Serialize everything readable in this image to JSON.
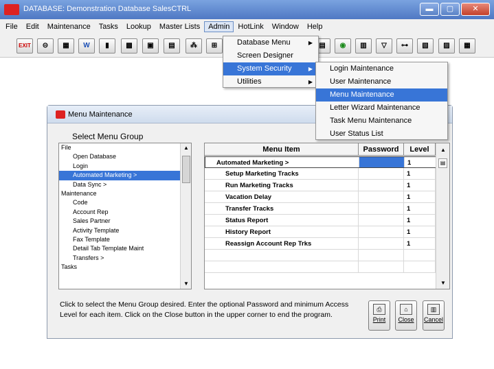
{
  "window": {
    "title": "DATABASE: Demonstration Database          SalesCTRL",
    "min_label": "▬",
    "max_label": "▢",
    "close_label": "✕"
  },
  "menubar": [
    "File",
    "Edit",
    "Maintenance",
    "Tasks",
    "Lookup",
    "Master Lists",
    "Admin",
    "HotLink",
    "Window",
    "Help"
  ],
  "toolbar": {
    "exit_label": "EXIT",
    "word_label": "W"
  },
  "admin_menu": [
    {
      "label": "Database Menu",
      "submenu": true
    },
    {
      "label": "Screen Designer",
      "submenu": false
    },
    {
      "label": "System Security",
      "submenu": true
    },
    {
      "label": "Utilities",
      "submenu": true
    }
  ],
  "security_menu": [
    "Login Maintenance",
    "User Maintenance",
    "Menu Maintenance",
    "Letter Wizard Maintenance",
    "Task Menu Maintenance",
    "User Status List"
  ],
  "child": {
    "title": "Menu Maintenance",
    "group_label": "Select Menu Group",
    "groups": [
      {
        "label": "File",
        "level": 1
      },
      {
        "label": "Open Database",
        "level": 2
      },
      {
        "label": "Login",
        "level": 2
      },
      {
        "label": "Automated Marketing >",
        "level": 2,
        "selected": true
      },
      {
        "label": "Data Sync >",
        "level": 2
      },
      {
        "label": "Maintenance",
        "level": 1
      },
      {
        "label": "Code",
        "level": 2
      },
      {
        "label": "Account Rep",
        "level": 2
      },
      {
        "label": "Sales Partner",
        "level": 2
      },
      {
        "label": "Activity Template",
        "level": 2
      },
      {
        "label": "Fax Template",
        "level": 2
      },
      {
        "label": "Detail Tab Template Maint",
        "level": 2
      },
      {
        "label": "Transfers >",
        "level": 2
      },
      {
        "label": "Tasks",
        "level": 1
      }
    ],
    "grid_headers": {
      "item": "Menu Item",
      "password": "Password",
      "level": "Level"
    },
    "grid_rows": [
      {
        "item": "Automated Marketing >",
        "level": "1",
        "top": true
      },
      {
        "item": "Setup Marketing Tracks",
        "level": "1"
      },
      {
        "item": "Run Marketing Tracks",
        "level": "1"
      },
      {
        "item": "Vacation Delay",
        "level": "1"
      },
      {
        "item": "Transfer Tracks",
        "level": "1"
      },
      {
        "item": "Status Report",
        "level": "1"
      },
      {
        "item": "History Report",
        "level": "1"
      },
      {
        "item": "Reassign Account Rep Trks",
        "level": "1"
      }
    ],
    "help_text": "Click to select the Menu Group desired. Enter the optional Password and minimum Access Level for each item. Click on the Close button in the upper corner to end the program.",
    "buttons": {
      "print": "Print",
      "close": "Close",
      "cancel": "Cancel"
    }
  }
}
